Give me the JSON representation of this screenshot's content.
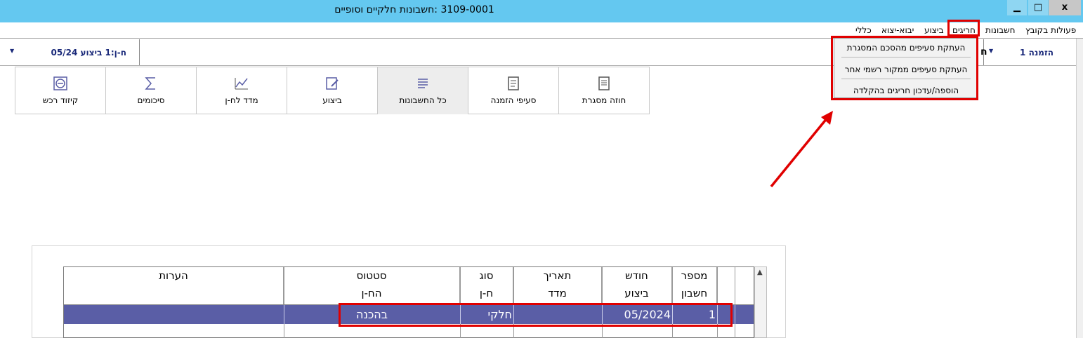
{
  "window": {
    "title": "3109-0001 :חשבונות חלקיים וסופיים",
    "minimize": "▁",
    "maximize": "□",
    "close": "x"
  },
  "menu": {
    "items": [
      "פעולות בקובץ",
      "חשבונות",
      "חריגים",
      "ביצוע",
      "יבוא-יצוא",
      "כללי"
    ]
  },
  "toolbar": {
    "left_combo": "ח-ן:1 ביצוע 05/24",
    "right_combo": "הזמנה 1",
    "right_combo_clip": "ח"
  },
  "dropdown": {
    "items": [
      "העתקת סעיפים מהסכם המסגרת",
      "העתקת סעיפים ממקור רשמי אחר",
      "הוספה/עדכון חריגים בהקלדה"
    ]
  },
  "tabs": [
    {
      "label": "חוזה מסגרת",
      "icon": "contract-icon"
    },
    {
      "label": "סעיפי הזמנה",
      "icon": "document-icon"
    },
    {
      "label": "כל החשבונות",
      "icon": "list-icon"
    },
    {
      "label": "ביצוע",
      "icon": "edit-icon"
    },
    {
      "label": "מדד לח-ן",
      "icon": "chart-icon"
    },
    {
      "label": "סיכומים",
      "icon": "sigma-icon"
    },
    {
      "label": "קיזוד רכש",
      "icon": "minus-circle-icon"
    }
  ],
  "grid": {
    "columns": [
      {
        "line1": "מספר",
        "line2": "חשבון"
      },
      {
        "line1": "חודש",
        "line2": "ביצוע"
      },
      {
        "line1": "תאריך",
        "line2": "מדד"
      },
      {
        "line1": "סוג",
        "line2": "ח-ן"
      },
      {
        "line1": "סטטוס",
        "line2": "הח-ן"
      },
      {
        "line1": "",
        "line2": "הערות"
      }
    ],
    "rows": [
      {
        "number": "1",
        "month": "05/2024",
        "index_date": "",
        "type": "חלקי",
        "status": "בהכנה",
        "notes": ""
      }
    ]
  },
  "colors": {
    "titlebar": "#64c8f0",
    "highlight": "#e00000",
    "selected_row": "#5a5ea6",
    "accent_text": "#1b2a7a"
  }
}
